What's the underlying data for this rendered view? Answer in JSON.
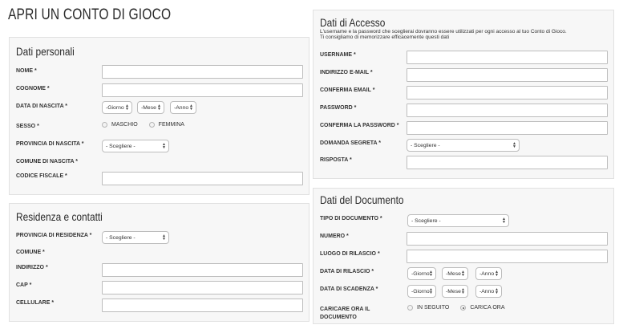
{
  "page": {
    "title": "APRI UN CONTO DI GIOCO"
  },
  "personal": {
    "title": "Dati personali",
    "nome_label": "NOME *",
    "cognome_label": "COGNOME *",
    "nascita_label": "DATA DI NASCITA *",
    "giorno": "-Giorno",
    "mese": "-Mese",
    "anno": "-Anno",
    "sesso_label": "SESSO *",
    "maschio": "MASCHIO",
    "femmina": "FEMMINA",
    "provincia_label": "PROVINCIA DI NASCITA *",
    "provincia_value": "- Scegliere -",
    "comune_label": "COMUNE DI NASCITA *",
    "cf_label": "CODICE FISCALE *"
  },
  "residence": {
    "title": "Residenza e contatti",
    "provincia_label": "PROVINCIA DI RESIDENZA *",
    "provincia_value": "- Scegliere -",
    "comune_label": "COMUNE *",
    "indirizzo_label": "INDIRIZZO *",
    "cap_label": "CAP *",
    "cellulare_label": "CELLULARE *"
  },
  "access": {
    "title": "Dati di Accesso",
    "sub1": "L'username e la password che sceglierai dovranno essere utilizzati per ogni accesso al tuo Conto di Gioco.",
    "sub2": "Ti consigliamo di memorizzare efficacemente questi dati",
    "username_label": "USERNAME *",
    "email_label": "INDIRIZZO E-MAIL *",
    "conf_email_label": "CONFERMA EMAIL *",
    "password_label": "PASSWORD *",
    "conf_password_label": "CONFERMA LA PASSWORD *",
    "domanda_label": "DOMANDA SEGRETA *",
    "domanda_value": "- Scegliere -",
    "risposta_label": "RISPOSTA *"
  },
  "document": {
    "title": "Dati del Documento",
    "tipo_label": "TIPO DI DOCUMENTO *",
    "tipo_value": "- Scegliere -",
    "numero_label": "NUMERO *",
    "luogo_label": "LUOGO DI RILASCIO *",
    "rilascio_label": "DATA DI RILASCIO *",
    "scadenza_label": "DATA DI SCADENZA *",
    "giorno": "-Giorno",
    "mese": "-Mese",
    "anno": "-Anno",
    "carica_label_1": "CARICARE ORA IL",
    "carica_label_2": "DOCUMENTO",
    "in_seguito": "IN SEGUITO",
    "carica_ora": "CARICA ORA"
  }
}
